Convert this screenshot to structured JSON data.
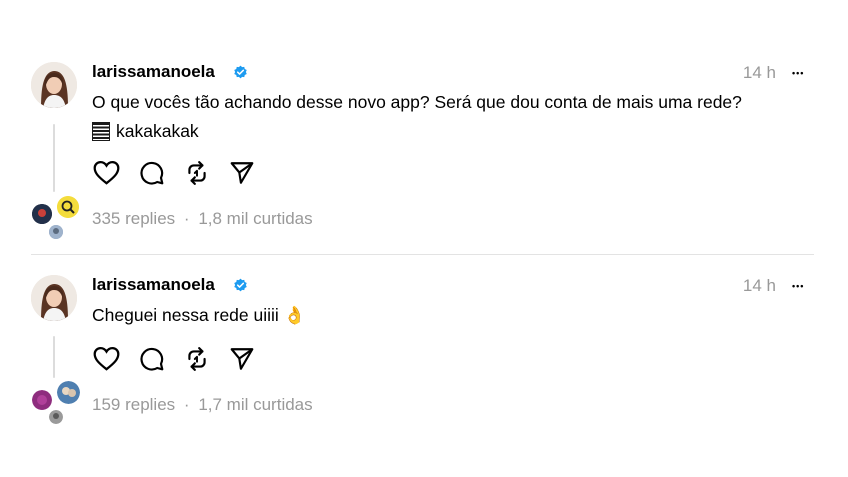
{
  "posts": [
    {
      "username": "larissamanoela",
      "time": "14 h",
      "more": "•••",
      "text_line1": "O que vocês tão achando desse novo app? Será que dou conta de mais uma rede?",
      "text_line2": "kakakakak",
      "replies": "335 replies",
      "separator": "·",
      "likes": "1,8 mil curtidas"
    },
    {
      "username": "larissamanoela",
      "time": "14 h",
      "more": "•••",
      "text_line1": "Cheguei nessa rede uiiii 👌",
      "replies": "159 replies",
      "separator": "·",
      "likes": "1,7 mil curtidas"
    }
  ],
  "icons": [
    "heart-icon",
    "comment-icon",
    "repost-icon",
    "share-icon",
    "verified-icon",
    "more-icon"
  ],
  "colors": {
    "verified": "#1d9bf0",
    "muted": "#999999",
    "divider": "#e3e3e3"
  }
}
